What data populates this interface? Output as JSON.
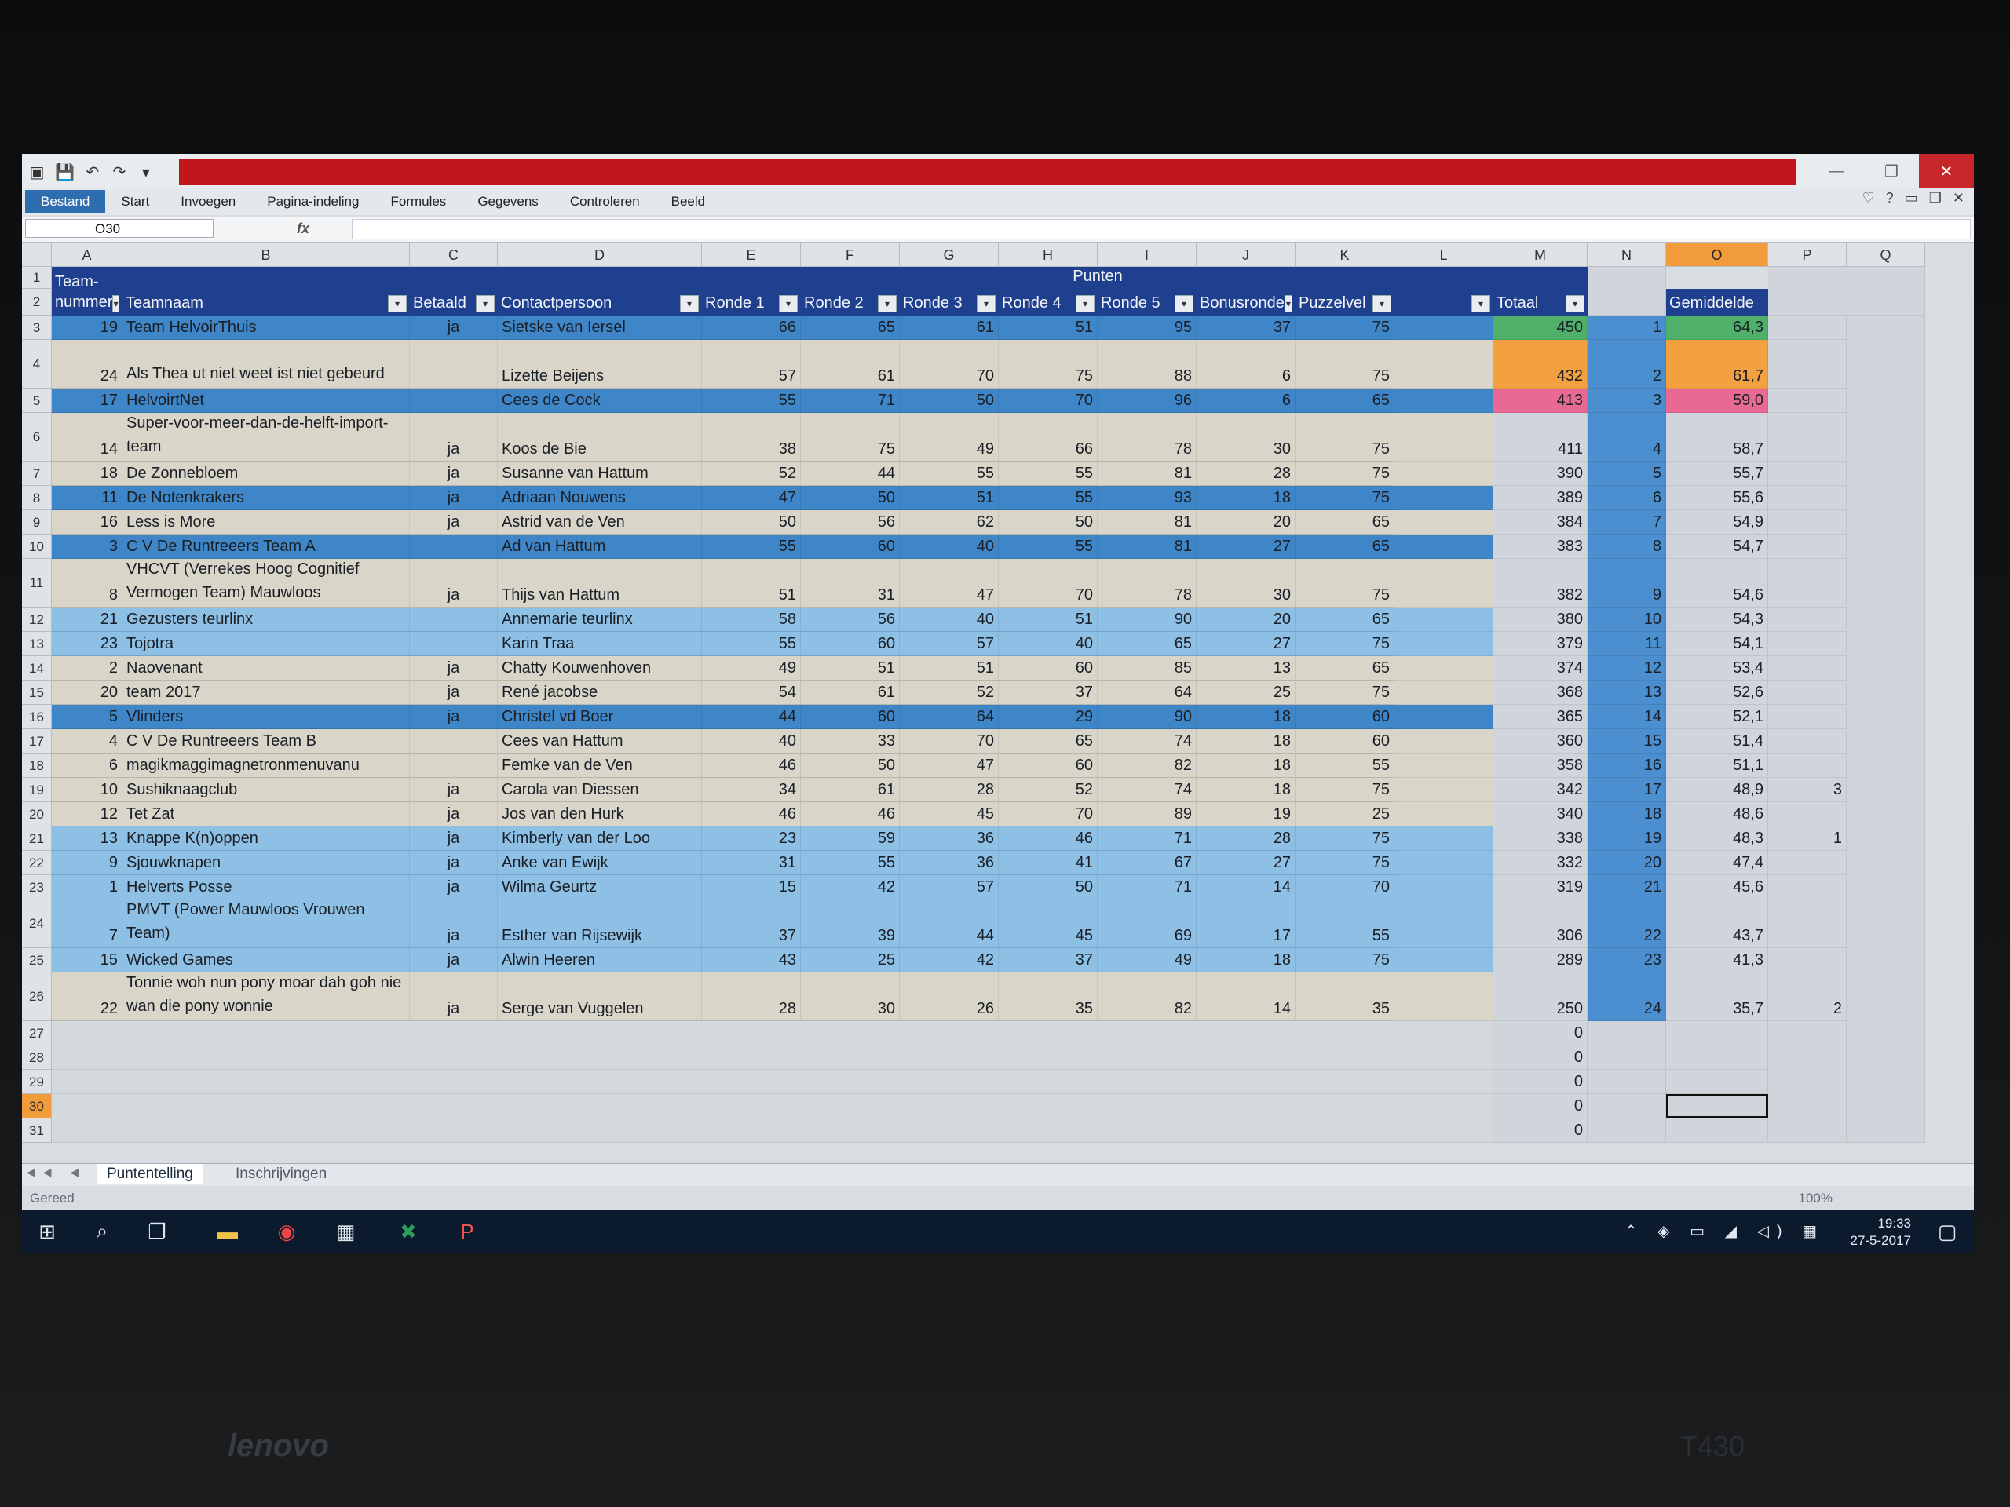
{
  "name_box": "O30",
  "formula": {
    "cancel": "×",
    "enter": "✓",
    "fx": "fx"
  },
  "window_controls": [
    "—",
    "❐",
    "✕"
  ],
  "ribbon_tabs": [
    "Bestand",
    "Start",
    "Invoegen",
    "Pagina-indeling",
    "Formules",
    "Gegevens",
    "Controleren",
    "Beeld"
  ],
  "columns": [
    "A",
    "B",
    "C",
    "D",
    "E",
    "F",
    "G",
    "H",
    "I",
    "J",
    "K",
    "L",
    "M",
    "N",
    "O",
    "P",
    "Q"
  ],
  "header": {
    "punten": "Punten",
    "team_nummer": "Team-\nnummer",
    "teamnaam": "Teamnaam",
    "betaald": "Betaald",
    "contactpersoon": "Contactpersoon",
    "ronde1": "Ronde 1",
    "ronde2": "Ronde 2",
    "ronde3": "Ronde 3",
    "ronde4": "Ronde 4",
    "ronde5": "Ronde 5",
    "bonusronde": "Bonusronde",
    "puzzelvel": "Puzzelvel",
    "totaal": "Totaal",
    "gemiddelde": "Gemiddelde"
  },
  "rows": [
    {
      "r": "3",
      "nr": "19",
      "team": "Team HelvoirThuis",
      "betaald": "ja",
      "contact": "Sietske van Iersel",
      "r1": "66",
      "r2": "65",
      "r3": "61",
      "r4": "51",
      "r5": "95",
      "bonus": "37",
      "puzzel": "75",
      "totaal": "450",
      "rank": "1",
      "gem": "64,3",
      "p": "",
      "style": "blue"
    },
    {
      "r": "4",
      "nr": "24",
      "team": "Als Thea ut niet weet ist niet gebeurd",
      "betaald": "",
      "contact": "Lizette Beijens",
      "r1": "57",
      "r2": "61",
      "r3": "70",
      "r4": "75",
      "r5": "88",
      "bonus": "6",
      "puzzel": "75",
      "totaal": "432",
      "rank": "2",
      "gem": "61,7",
      "p": "",
      "style": "light"
    },
    {
      "r": "5",
      "nr": "17",
      "team": "HelvoirtNet",
      "betaald": "",
      "contact": "Cees de Cock",
      "r1": "55",
      "r2": "71",
      "r3": "50",
      "r4": "70",
      "r5": "96",
      "bonus": "6",
      "puzzel": "65",
      "totaal": "413",
      "rank": "3",
      "gem": "59,0",
      "p": "",
      "style": "blue"
    },
    {
      "r": "6",
      "nr": "14",
      "team": "Super-voor-meer-dan-de-helft-import-team",
      "betaald": "ja",
      "contact": "Koos de Bie",
      "r1": "38",
      "r2": "75",
      "r3": "49",
      "r4": "66",
      "r5": "78",
      "bonus": "30",
      "puzzel": "75",
      "totaal": "411",
      "rank": "4",
      "gem": "58,7",
      "p": "",
      "style": "light"
    },
    {
      "r": "7",
      "nr": "18",
      "team": "De Zonnebloem",
      "betaald": "ja",
      "contact": "Susanne van Hattum",
      "r1": "52",
      "r2": "44",
      "r3": "55",
      "r4": "55",
      "r5": "81",
      "bonus": "28",
      "puzzel": "75",
      "totaal": "390",
      "rank": "5",
      "gem": "55,7",
      "p": "",
      "style": "light"
    },
    {
      "r": "8",
      "nr": "11",
      "team": "De Notenkrakers",
      "betaald": "ja",
      "contact": "Adriaan Nouwens",
      "r1": "47",
      "r2": "50",
      "r3": "51",
      "r4": "55",
      "r5": "93",
      "bonus": "18",
      "puzzel": "75",
      "totaal": "389",
      "rank": "6",
      "gem": "55,6",
      "p": "",
      "style": "blue"
    },
    {
      "r": "9",
      "nr": "16",
      "team": "Less is More",
      "betaald": "ja",
      "contact": "Astrid van de Ven",
      "r1": "50",
      "r2": "56",
      "r3": "62",
      "r4": "50",
      "r5": "81",
      "bonus": "20",
      "puzzel": "65",
      "totaal": "384",
      "rank": "7",
      "gem": "54,9",
      "p": "",
      "style": "light"
    },
    {
      "r": "10",
      "nr": "3",
      "team": "C V De Runtreeers Team A",
      "betaald": "",
      "contact": "Ad van Hattum",
      "r1": "55",
      "r2": "60",
      "r3": "40",
      "r4": "55",
      "r5": "81",
      "bonus": "27",
      "puzzel": "65",
      "totaal": "383",
      "rank": "8",
      "gem": "54,7",
      "p": "",
      "style": "blue"
    },
    {
      "r": "11",
      "nr": "8",
      "team": "VHCVT (Verrekes Hoog Cognitief Vermogen Team) Mauwloos",
      "betaald": "ja",
      "contact": "Thijs van Hattum",
      "r1": "51",
      "r2": "31",
      "r3": "47",
      "r4": "70",
      "r5": "78",
      "bonus": "30",
      "puzzel": "75",
      "totaal": "382",
      "rank": "9",
      "gem": "54,6",
      "p": "",
      "style": "light"
    },
    {
      "r": "12",
      "nr": "21",
      "team": "Gezusters teurlinx",
      "betaald": "",
      "contact": "Annemarie teurlinx",
      "r1": "58",
      "r2": "56",
      "r3": "40",
      "r4": "51",
      "r5": "90",
      "bonus": "20",
      "puzzel": "65",
      "totaal": "380",
      "rank": "10",
      "gem": "54,3",
      "p": "",
      "style": "mid"
    },
    {
      "r": "13",
      "nr": "23",
      "team": "Tojotra",
      "betaald": "",
      "contact": "Karin Traa",
      "r1": "55",
      "r2": "60",
      "r3": "57",
      "r4": "40",
      "r5": "65",
      "bonus": "27",
      "puzzel": "75",
      "totaal": "379",
      "rank": "11",
      "gem": "54,1",
      "p": "",
      "style": "mid"
    },
    {
      "r": "14",
      "nr": "2",
      "team": "Naovenant",
      "betaald": "ja",
      "contact": "Chatty Kouwenhoven",
      "r1": "49",
      "r2": "51",
      "r3": "51",
      "r4": "60",
      "r5": "85",
      "bonus": "13",
      "puzzel": "65",
      "totaal": "374",
      "rank": "12",
      "gem": "53,4",
      "p": "",
      "style": "light"
    },
    {
      "r": "15",
      "nr": "20",
      "team": "team 2017",
      "betaald": "ja",
      "contact": "René jacobse",
      "r1": "54",
      "r2": "61",
      "r3": "52",
      "r4": "37",
      "r5": "64",
      "bonus": "25",
      "puzzel": "75",
      "totaal": "368",
      "rank": "13",
      "gem": "52,6",
      "p": "",
      "style": "light"
    },
    {
      "r": "16",
      "nr": "5",
      "team": "Vlinders",
      "betaald": "ja",
      "contact": "Christel vd Boer",
      "r1": "44",
      "r2": "60",
      "r3": "64",
      "r4": "29",
      "r5": "90",
      "bonus": "18",
      "puzzel": "60",
      "totaal": "365",
      "rank": "14",
      "gem": "52,1",
      "p": "",
      "style": "blue"
    },
    {
      "r": "17",
      "nr": "4",
      "team": "C V De Runtreeers Team B",
      "betaald": "",
      "contact": "Cees van Hattum",
      "r1": "40",
      "r2": "33",
      "r3": "70",
      "r4": "65",
      "r5": "74",
      "bonus": "18",
      "puzzel": "60",
      "totaal": "360",
      "rank": "15",
      "gem": "51,4",
      "p": "",
      "style": "light"
    },
    {
      "r": "18",
      "nr": "6",
      "team": "magikmaggimagnetronmenuvanu",
      "betaald": "",
      "contact": "Femke van de Ven",
      "r1": "46",
      "r2": "50",
      "r3": "47",
      "r4": "60",
      "r5": "82",
      "bonus": "18",
      "puzzel": "55",
      "totaal": "358",
      "rank": "16",
      "gem": "51,1",
      "p": "",
      "style": "light"
    },
    {
      "r": "19",
      "nr": "10",
      "team": "Sushiknaagclub",
      "betaald": "ja",
      "contact": "Carola van Diessen",
      "r1": "34",
      "r2": "61",
      "r3": "28",
      "r4": "52",
      "r5": "74",
      "bonus": "18",
      "puzzel": "75",
      "totaal": "342",
      "rank": "17",
      "gem": "48,9",
      "p": "3",
      "style": "light"
    },
    {
      "r": "20",
      "nr": "12",
      "team": "Tet Zat",
      "betaald": "ja",
      "contact": "Jos van den Hurk",
      "r1": "46",
      "r2": "46",
      "r3": "45",
      "r4": "70",
      "r5": "89",
      "bonus": "19",
      "puzzel": "25",
      "totaal": "340",
      "rank": "18",
      "gem": "48,6",
      "p": "",
      "style": "light"
    },
    {
      "r": "21",
      "nr": "13",
      "team": "Knappe K(n)oppen",
      "betaald": "ja",
      "contact": "Kimberly van der Loo",
      "r1": "23",
      "r2": "59",
      "r3": "36",
      "r4": "46",
      "r5": "71",
      "bonus": "28",
      "puzzel": "75",
      "totaal": "338",
      "rank": "19",
      "gem": "48,3",
      "p": "1",
      "style": "mid"
    },
    {
      "r": "22",
      "nr": "9",
      "team": "Sjouwknapen",
      "betaald": "ja",
      "contact": "Anke van Ewijk",
      "r1": "31",
      "r2": "55",
      "r3": "36",
      "r4": "41",
      "r5": "67",
      "bonus": "27",
      "puzzel": "75",
      "totaal": "332",
      "rank": "20",
      "gem": "47,4",
      "p": "",
      "style": "mid"
    },
    {
      "r": "23",
      "nr": "1",
      "team": "Helverts Posse",
      "betaald": "ja",
      "contact": "Wilma Geurtz",
      "r1": "15",
      "r2": "42",
      "r3": "57",
      "r4": "50",
      "r5": "71",
      "bonus": "14",
      "puzzel": "70",
      "totaal": "319",
      "rank": "21",
      "gem": "45,6",
      "p": "",
      "style": "mid"
    },
    {
      "r": "24",
      "nr": "7",
      "team": "PMVT (Power Mauwloos Vrouwen Team)",
      "betaald": "ja",
      "contact": "Esther van Rijsewijk",
      "r1": "37",
      "r2": "39",
      "r3": "44",
      "r4": "45",
      "r5": "69",
      "bonus": "17",
      "puzzel": "55",
      "totaal": "306",
      "rank": "22",
      "gem": "43,7",
      "p": "",
      "style": "mid"
    },
    {
      "r": "25",
      "nr": "15",
      "team": "Wicked Games",
      "betaald": "ja",
      "contact": "Alwin Heeren",
      "r1": "43",
      "r2": "25",
      "r3": "42",
      "r4": "37",
      "r5": "49",
      "bonus": "18",
      "puzzel": "75",
      "totaal": "289",
      "rank": "23",
      "gem": "41,3",
      "p": "",
      "style": "mid"
    },
    {
      "r": "26",
      "nr": "22",
      "team": "Tonnie woh nun pony moar dah goh nie wan die pony wonnie",
      "betaald": "ja",
      "contact": "Serge van Vuggelen",
      "r1": "28",
      "r2": "30",
      "r3": "26",
      "r4": "35",
      "r5": "82",
      "bonus": "14",
      "puzzel": "35",
      "totaal": "250",
      "rank": "24",
      "gem": "35,7",
      "p": "2",
      "style": "light"
    }
  ],
  "empty_rows": [
    {
      "r": "27",
      "totaal": "0"
    },
    {
      "r": "28",
      "totaal": "0"
    },
    {
      "r": "29",
      "totaal": "0"
    },
    {
      "r": "30",
      "totaal": "0"
    },
    {
      "r": "31",
      "totaal": "0"
    }
  ],
  "sheet_tabs": [
    "Puntentelling",
    "Inschrijvingen"
  ],
  "status": "Gereed",
  "zoom": "100%",
  "clock": {
    "time": "19:33",
    "date": "27-5-2017"
  },
  "laptop": {
    "brand": "lenovo",
    "model": "T430"
  },
  "colors": {
    "header_blue": "#1f3f8f",
    "row_blue": "#3f86c9",
    "row_mid": "#8ec0e6",
    "row_light": "#d9d6c9",
    "rank1": "#4fb06a",
    "rank2": "#f2a040",
    "rank3": "#e86a94"
  }
}
